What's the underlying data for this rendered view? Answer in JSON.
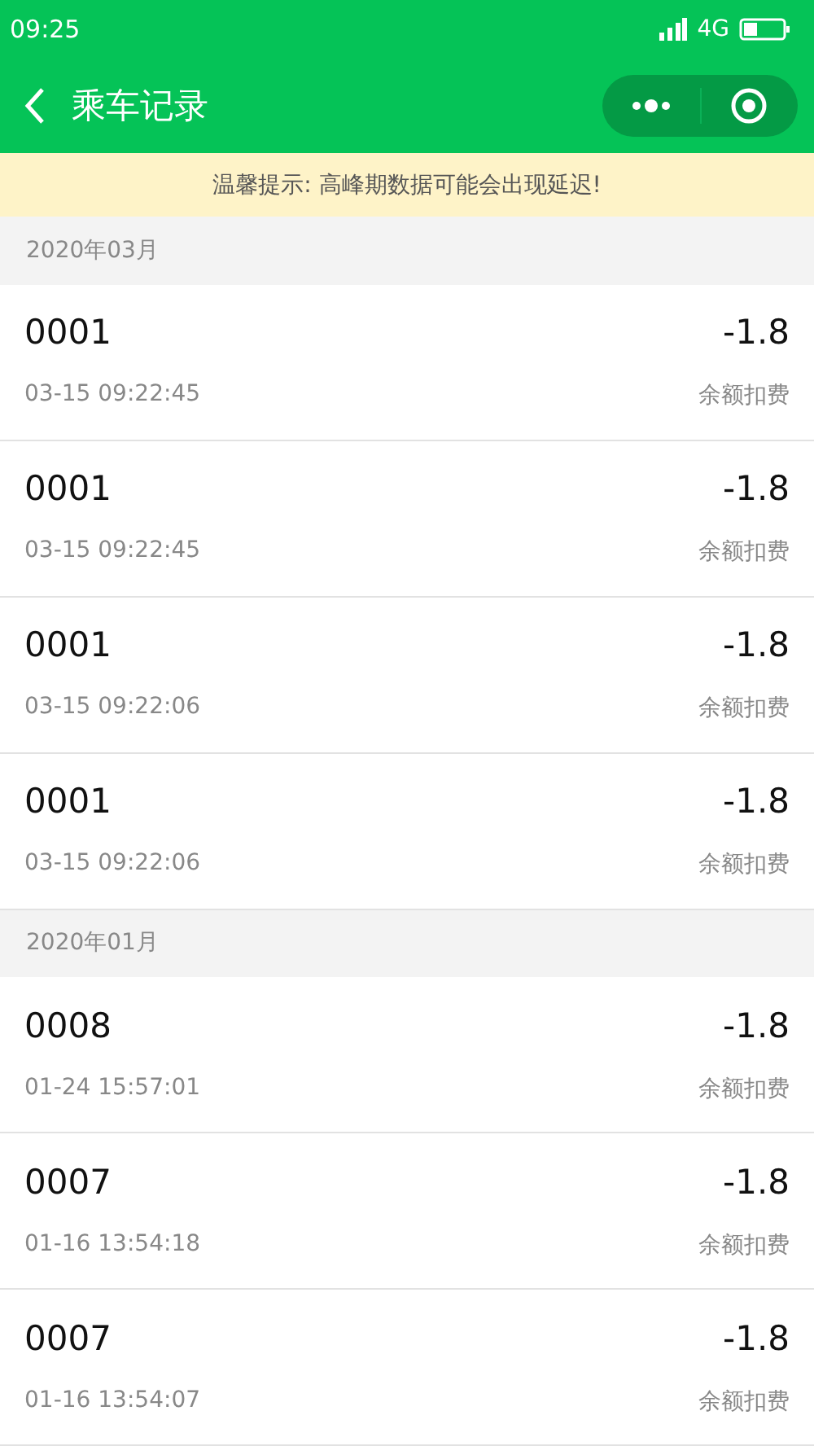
{
  "status_bar": {
    "time": "09:25",
    "network": "4G"
  },
  "nav": {
    "title": "乘车记录"
  },
  "notice": "温馨提示: 高峰期数据可能会出现延迟!",
  "sections": [
    {
      "title": "2020年03月",
      "records": [
        {
          "line": "0001",
          "amount": "-1.8",
          "time": "03-15 09:22:45",
          "type": "余额扣费"
        },
        {
          "line": "0001",
          "amount": "-1.8",
          "time": "03-15 09:22:45",
          "type": "余额扣费"
        },
        {
          "line": "0001",
          "amount": "-1.8",
          "time": "03-15 09:22:06",
          "type": "余额扣费"
        },
        {
          "line": "0001",
          "amount": "-1.8",
          "time": "03-15 09:22:06",
          "type": "余额扣费"
        }
      ]
    },
    {
      "title": "2020年01月",
      "records": [
        {
          "line": "0008",
          "amount": "-1.8",
          "time": "01-24 15:57:01",
          "type": "余额扣费"
        },
        {
          "line": "0007",
          "amount": "-1.8",
          "time": "01-16 13:54:18",
          "type": "余额扣费"
        },
        {
          "line": "0007",
          "amount": "-1.8",
          "time": "01-16 13:54:07",
          "type": "余额扣费"
        }
      ]
    }
  ]
}
